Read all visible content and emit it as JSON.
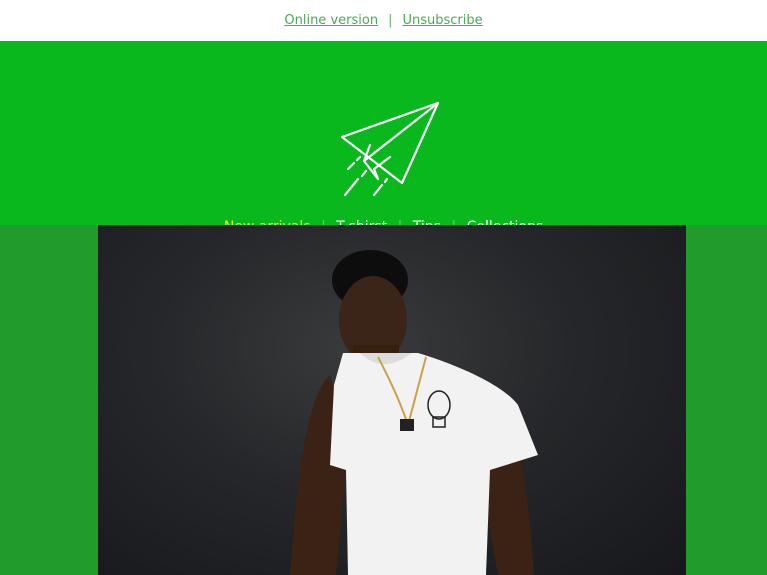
{
  "topbar": {
    "online_version": "Online version",
    "separator": "|",
    "unsubscribe": "Unsubscribe"
  },
  "header": {
    "logo_icon": "paper-plane-icon",
    "nav": [
      {
        "label": "New arrivals",
        "active": true
      },
      {
        "label": "T-shirst",
        "active": false
      },
      {
        "label": "Tips",
        "active": false
      },
      {
        "label": "Collections",
        "active": false
      }
    ],
    "divider": "|"
  },
  "hero": {
    "image": "man-in-white-tshirt-photo"
  },
  "colors": {
    "header_bg": "#08b81c",
    "body_bg": "#229b2d",
    "active_nav": "#e7f01b",
    "link": "#4aa85a"
  }
}
